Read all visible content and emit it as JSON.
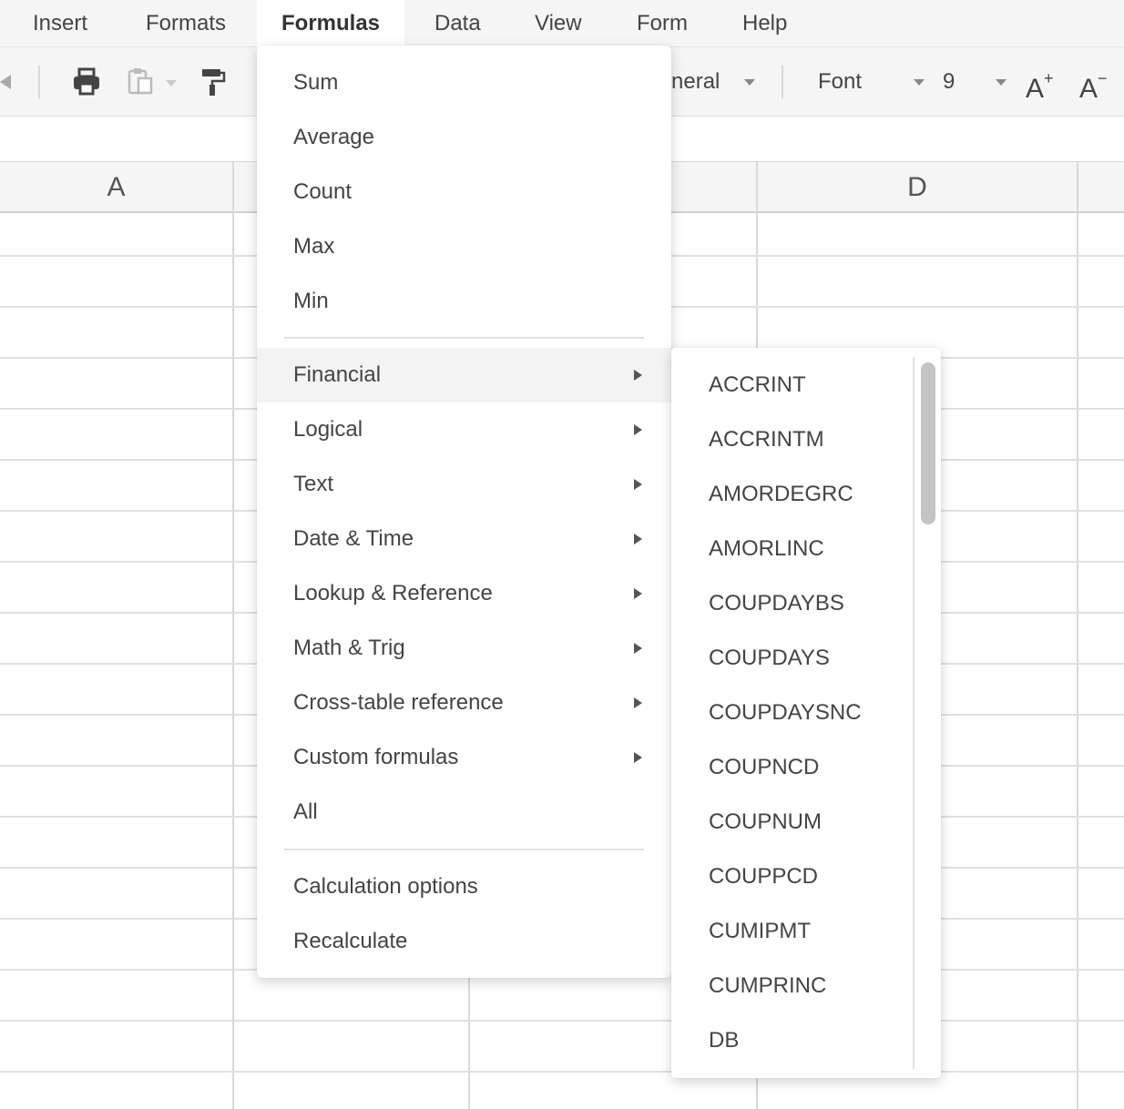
{
  "menubar": {
    "items": [
      {
        "label": "Insert"
      },
      {
        "label": "Formats"
      },
      {
        "label": "Formulas"
      },
      {
        "label": "Data"
      },
      {
        "label": "View"
      },
      {
        "label": "Form"
      },
      {
        "label": "Help"
      }
    ]
  },
  "toolbar": {
    "number_format": "neral",
    "font": "Font",
    "font_size": "9",
    "increase_font": "A",
    "increase_font_sup": "+",
    "decrease_font": "A",
    "decrease_font_sup": "−"
  },
  "grid": {
    "columns": [
      "A",
      "D"
    ]
  },
  "formulas_menu": {
    "basic": [
      {
        "label": "Sum"
      },
      {
        "label": "Average"
      },
      {
        "label": "Count"
      },
      {
        "label": "Max"
      },
      {
        "label": "Min"
      }
    ],
    "categories": [
      {
        "label": "Financial"
      },
      {
        "label": "Logical"
      },
      {
        "label": "Text"
      },
      {
        "label": "Date & Time"
      },
      {
        "label": "Lookup & Reference"
      },
      {
        "label": "Math & Trig"
      },
      {
        "label": "Cross-table reference"
      },
      {
        "label": "Custom formulas"
      },
      {
        "label": "All"
      }
    ],
    "actions": [
      {
        "label": "Calculation options"
      },
      {
        "label": "Recalculate"
      }
    ]
  },
  "financial_submenu": {
    "items": [
      "ACCRINT",
      "ACCRINTM",
      "AMORDEGRC",
      "AMORLINC",
      "COUPDAYBS",
      "COUPDAYS",
      "COUPDAYSNC",
      "COUPNCD",
      "COUPNUM",
      "COUPPCD",
      "CUMIPMT",
      "CUMPRINC",
      "DB"
    ]
  }
}
